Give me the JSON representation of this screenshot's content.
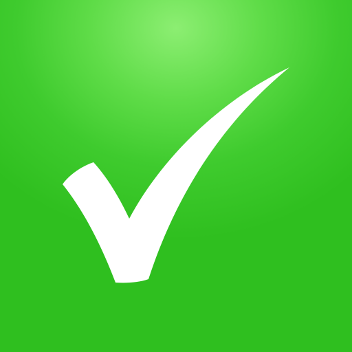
{
  "icon": {
    "name": "checkmark-icon",
    "background_color": "#3fcb2e",
    "highlight_color": "#8cee72",
    "mark_color": "#ffffff"
  }
}
